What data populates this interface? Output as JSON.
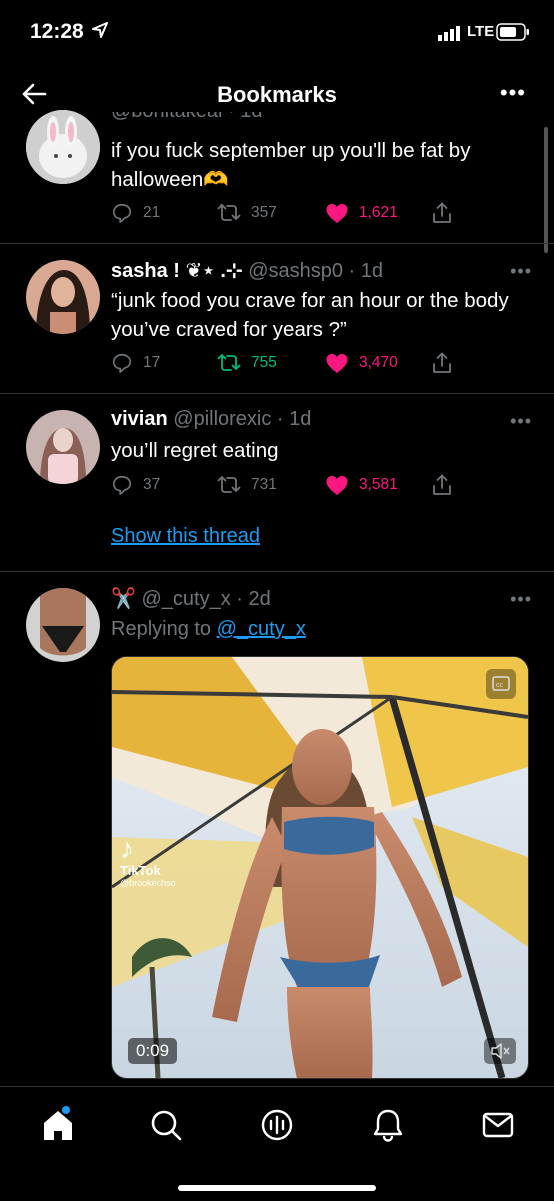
{
  "status_bar": {
    "time": "12:28",
    "network": "LTE"
  },
  "header": {
    "title": "Bookmarks"
  },
  "tweets": [
    {
      "name": "",
      "handle": "@bonitakeal · 1d",
      "text": "if you fuck september up you'll be fat by halloween🫶",
      "replies": "21",
      "retweets": "357",
      "likes": "1,621"
    },
    {
      "name": "sasha ! ❦⋆ .⊹",
      "handle": "@sashsp0 · 1d",
      "text": "“junk food you crave for an hour or the body you’ve craved for years ?”",
      "replies": "17",
      "retweets": "755",
      "likes": "3,470"
    },
    {
      "name": "vivian",
      "handle": "@pillorexic · 1d",
      "text": "you’ll regret eating",
      "replies": "37",
      "retweets": "731",
      "likes": "3,581",
      "thread_link": "Show this thread"
    },
    {
      "name": "✂️",
      "handle": "@_cuty_x · 2d",
      "replying_prefix": "Replying to",
      "replying_to": "@_cuty_x",
      "media": {
        "duration": "0:09",
        "watermark": "TikTok",
        "watermark_handle": "@brookechso"
      }
    }
  ],
  "colors": {
    "background": "#000000",
    "link": "#1d9bf0",
    "like": "#f91880",
    "retweet": "#00ba7c",
    "muted": "#71767b"
  },
  "tab_bar": {
    "icons": [
      "home-icon",
      "search-icon",
      "spaces-icon",
      "notifications-icon",
      "messages-icon"
    ]
  }
}
